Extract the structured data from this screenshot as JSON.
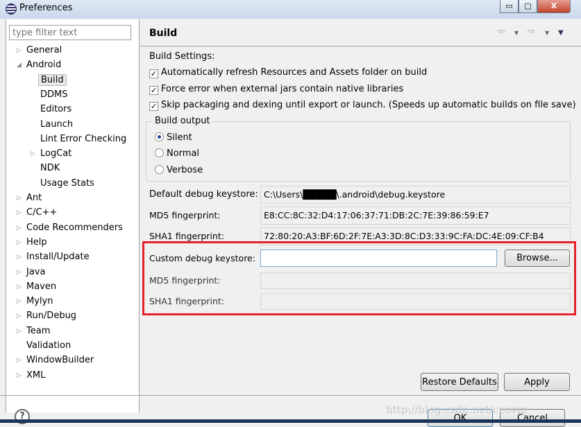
{
  "window": {
    "title": "Preferences",
    "minimize_icon": "minimize-icon",
    "maximize_icon": "maximize-icon",
    "close_label": "X"
  },
  "sidebar": {
    "filter_placeholder": "type filter text",
    "items": [
      {
        "label": "General",
        "level": 0,
        "expandable": true
      },
      {
        "label": "Android",
        "level": 0,
        "expanded": true
      },
      {
        "label": "Build",
        "level": 1,
        "selected": true
      },
      {
        "label": "DDMS",
        "level": 1
      },
      {
        "label": "Editors",
        "level": 1
      },
      {
        "label": "Launch",
        "level": 1
      },
      {
        "label": "Lint Error Checking",
        "level": 1
      },
      {
        "label": "LogCat",
        "level": 1,
        "expandable": true
      },
      {
        "label": "NDK",
        "level": 1
      },
      {
        "label": "Usage Stats",
        "level": 1
      },
      {
        "label": "Ant",
        "level": 0,
        "expandable": true
      },
      {
        "label": "C/C++",
        "level": 0,
        "expandable": true
      },
      {
        "label": "Code Recommenders",
        "level": 0,
        "expandable": true
      },
      {
        "label": "Help",
        "level": 0,
        "expandable": true
      },
      {
        "label": "Install/Update",
        "level": 0,
        "expandable": true
      },
      {
        "label": "Java",
        "level": 0,
        "expandable": true
      },
      {
        "label": "Maven",
        "level": 0,
        "expandable": true
      },
      {
        "label": "Mylyn",
        "level": 0,
        "expandable": true
      },
      {
        "label": "Run/Debug",
        "level": 0,
        "expandable": true
      },
      {
        "label": "Team",
        "level": 0,
        "expandable": true
      },
      {
        "label": "Validation",
        "level": 0
      },
      {
        "label": "WindowBuilder",
        "level": 0,
        "expandable": true
      },
      {
        "label": "XML",
        "level": 0,
        "expandable": true
      }
    ]
  },
  "page": {
    "title": "Build",
    "settings_label": "Build Settings:",
    "checkboxes": [
      {
        "label": "Automatically refresh Resources and Assets folder on build",
        "checked": true
      },
      {
        "label": "Force error when external jars contain native libraries",
        "checked": true
      },
      {
        "label": "Skip packaging and dexing until export or launch. (Speeds up automatic builds on file save)",
        "checked": true
      }
    ],
    "build_output": {
      "label": "Build output",
      "options": [
        "Silent",
        "Normal",
        "Verbose"
      ],
      "selected": "Silent"
    },
    "default_keystore": {
      "label": "Default debug keystore:",
      "value": "C:\\Users\\█████\\.android\\debug.keystore"
    },
    "default_md5": {
      "label": "MD5 fingerprint:",
      "value": "E8:CC:8C:32:D4:17:06:37:71:DB:2C:7E:39:86:59:E7"
    },
    "default_sha1": {
      "label": "SHA1 fingerprint:",
      "value": "72:80:20:A3:BF:6D:2F:7E:A3:3D:8C:D3:33:9C:FA:DC:4E:09:CF:B4"
    },
    "custom_keystore": {
      "label": "Custom debug keystore:",
      "value": "",
      "browse": "Browse..."
    },
    "custom_md5": {
      "label": "MD5 fingerprint:",
      "value": ""
    },
    "custom_sha1": {
      "label": "SHA1 fingerprint:",
      "value": ""
    },
    "highlight_color": "#e8202a",
    "restore_defaults": "Restore Defaults",
    "apply": "Apply"
  },
  "footer": {
    "ok": "OK",
    "cancel": "Cancel",
    "help": "?",
    "watermark": "http://blog.csdn.net/ceovip"
  }
}
